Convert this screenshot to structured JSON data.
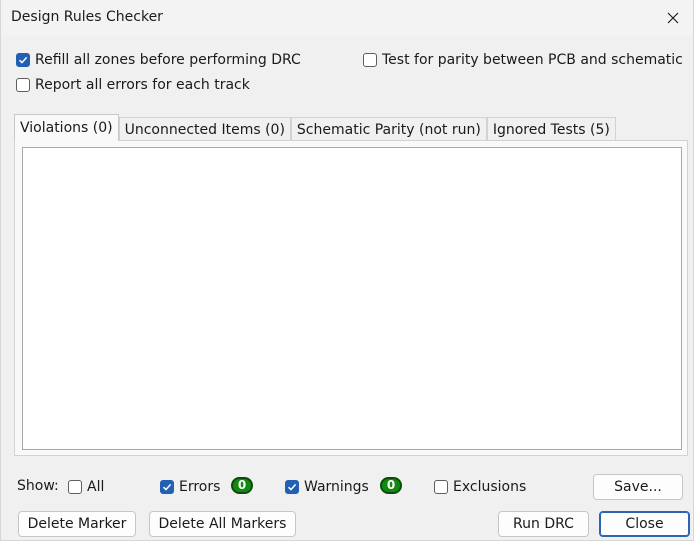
{
  "window": {
    "title": "Design Rules Checker"
  },
  "options": {
    "refill_zones": {
      "label": "Refill all zones before performing DRC",
      "checked": true
    },
    "report_all_errors": {
      "label": "Report all errors for each track",
      "checked": false
    },
    "test_parity": {
      "label": "Test for parity between PCB and schematic",
      "checked": false
    }
  },
  "tabs": [
    {
      "label": "Violations (0)",
      "active": true
    },
    {
      "label": "Unconnected Items (0)",
      "active": false
    },
    {
      "label": "Schematic Parity (not run)",
      "active": false
    },
    {
      "label": "Ignored Tests (5)",
      "active": false
    }
  ],
  "filters": {
    "show_label": "Show:",
    "all": {
      "label": "All",
      "checked": false
    },
    "errors": {
      "label": "Errors",
      "checked": true,
      "count": "0"
    },
    "warnings": {
      "label": "Warnings",
      "checked": true,
      "count": "0"
    },
    "exclusions": {
      "label": "Exclusions",
      "checked": false
    },
    "save_label": "Save..."
  },
  "buttons": {
    "delete_marker": "Delete Marker",
    "delete_all_markers": "Delete All Markers",
    "run_drc": "Run DRC",
    "close": "Close"
  },
  "colors": {
    "accent": "#2360b5",
    "badge_green": "#118811"
  }
}
